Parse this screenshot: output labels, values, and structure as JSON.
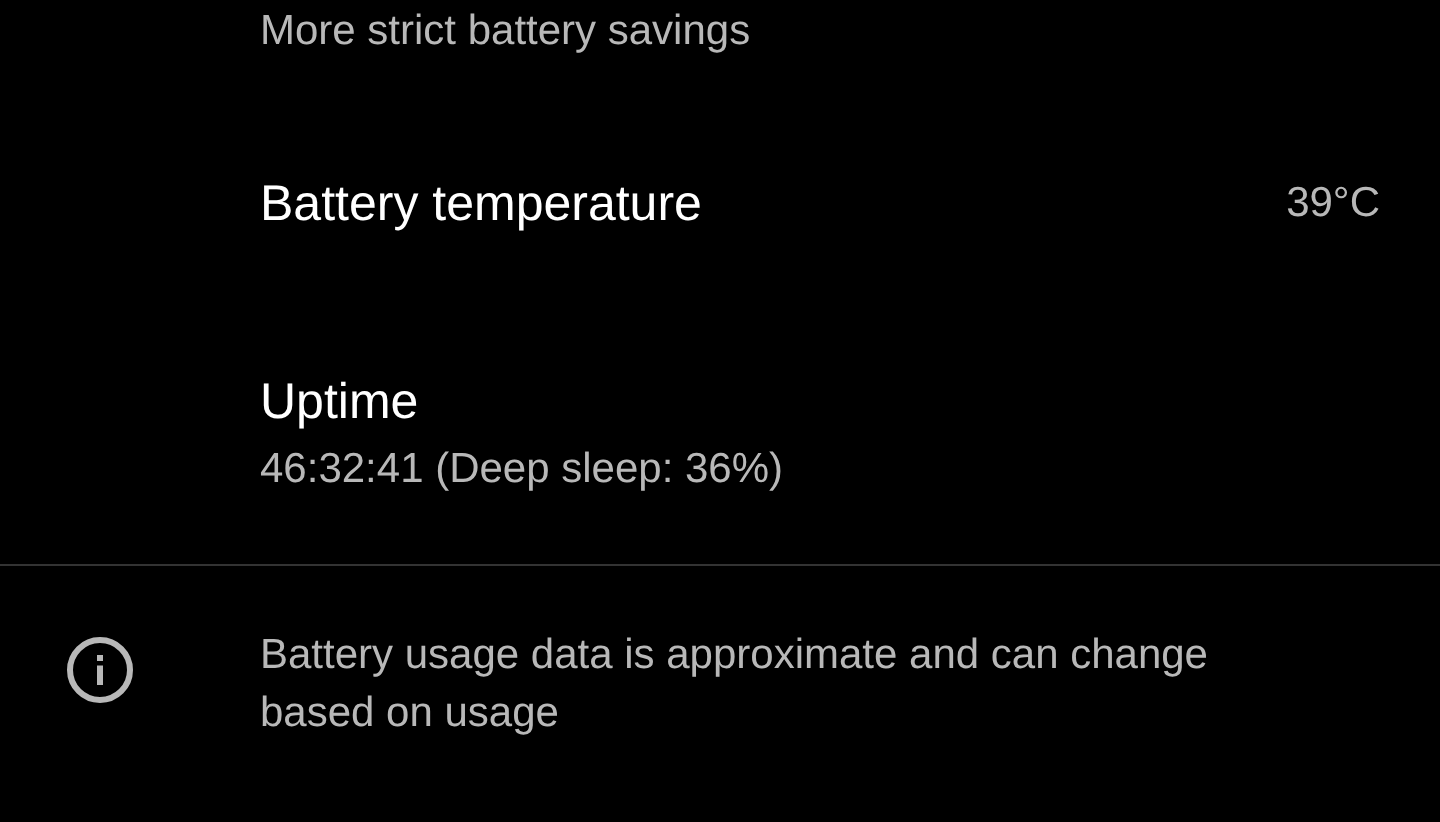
{
  "items": [
    {
      "kind": "subtitle_only",
      "subtitle": "More strict battery savings"
    },
    {
      "kind": "value",
      "title": "Battery temperature",
      "value": "39°C"
    },
    {
      "kind": "two_line",
      "title": "Uptime",
      "subtitle": "46:32:41 (Deep sleep: 36%)"
    }
  ],
  "footer": {
    "text": "Battery usage data is approximate and can change based on usage"
  }
}
